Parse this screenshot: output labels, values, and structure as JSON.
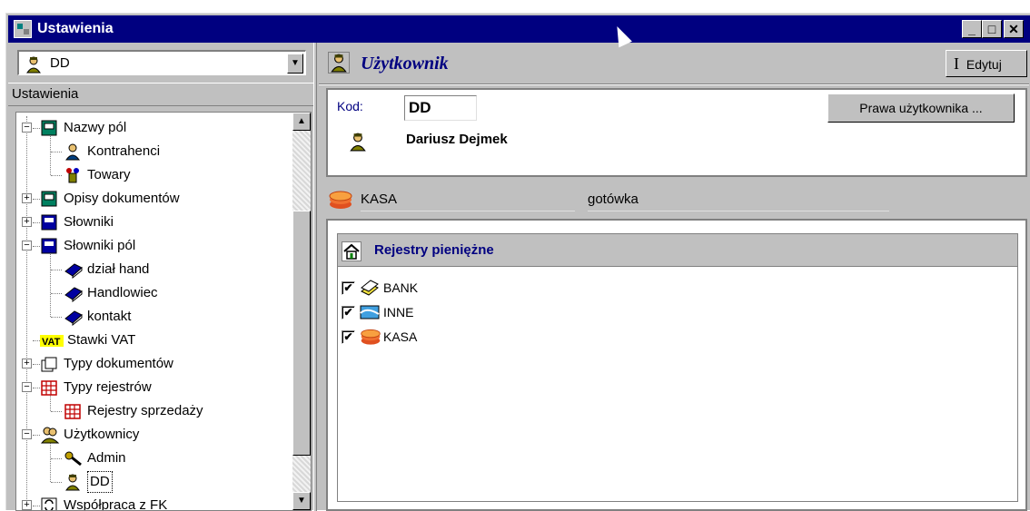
{
  "window": {
    "title": "Ustawienia",
    "controls": {
      "minimize": "_",
      "maximize": "□",
      "close": "✕"
    }
  },
  "left": {
    "combo_value": "DD",
    "header": "Ustawienia",
    "tree": [
      {
        "label": "Nazwy pól",
        "icon": "form-icon",
        "expander": "−",
        "indent": 0
      },
      {
        "label": "Kontrahenci",
        "icon": "contractor-icon",
        "indent": 1
      },
      {
        "label": "Towary",
        "icon": "goods-icon",
        "indent": 1
      },
      {
        "label": "Opisy dokumentów",
        "icon": "form-icon",
        "expander": "+",
        "indent": 0
      },
      {
        "label": "Słowniki",
        "icon": "dictionary-icon",
        "expander": "+",
        "indent": 0
      },
      {
        "label": "Słowniki pól",
        "icon": "dictionary-icon",
        "expander": "−",
        "indent": 0
      },
      {
        "label": "dział hand",
        "icon": "book-icon",
        "indent": 1
      },
      {
        "label": "Handlowiec",
        "icon": "book-icon",
        "indent": 1
      },
      {
        "label": "kontakt",
        "icon": "book-icon",
        "indent": 1
      },
      {
        "label": "Stawki VAT",
        "icon": "vat-icon",
        "icon_text": "VAT",
        "indent": 0
      },
      {
        "label": "Typy dokumentów",
        "icon": "documents-icon",
        "expander": "+",
        "indent": 0
      },
      {
        "label": "Typy rejestrów",
        "icon": "register-grid-icon",
        "expander": "−",
        "indent": 0
      },
      {
        "label": "Rejestry sprzedaży",
        "icon": "register-grid-icon",
        "indent": 1
      },
      {
        "label": "Użytkownicy",
        "icon": "users-icon",
        "expander": "−",
        "indent": 0
      },
      {
        "label": "Admin",
        "icon": "admin-key-icon",
        "indent": 1
      },
      {
        "label": "DD",
        "icon": "user-icon",
        "indent": 1,
        "selected": true
      },
      {
        "label": "Współpraca z FK",
        "icon": "sync-icon",
        "expander": "+",
        "indent": 0
      }
    ]
  },
  "right": {
    "title": "Użytkownik",
    "edit_label": "Edytuj",
    "kod_label": "Kod:",
    "kod_value": "DD",
    "user_name": "Dariusz Dejmek",
    "permissions_label": "Prawa użytkownika ...",
    "kasa_name": "KASA",
    "kasa_type": "gotówka",
    "registers_title": "Rejestry pieniężne",
    "registers": [
      {
        "label": "BANK",
        "checked": true,
        "icon": "bank-icon"
      },
      {
        "label": "INNE",
        "checked": true,
        "icon": "other-register-icon"
      },
      {
        "label": "KASA",
        "checked": true,
        "icon": "cash-register-icon"
      }
    ]
  },
  "colors": {
    "title_bar": "#000080",
    "face": "#c0c0c0",
    "accent_text": "#000080"
  }
}
